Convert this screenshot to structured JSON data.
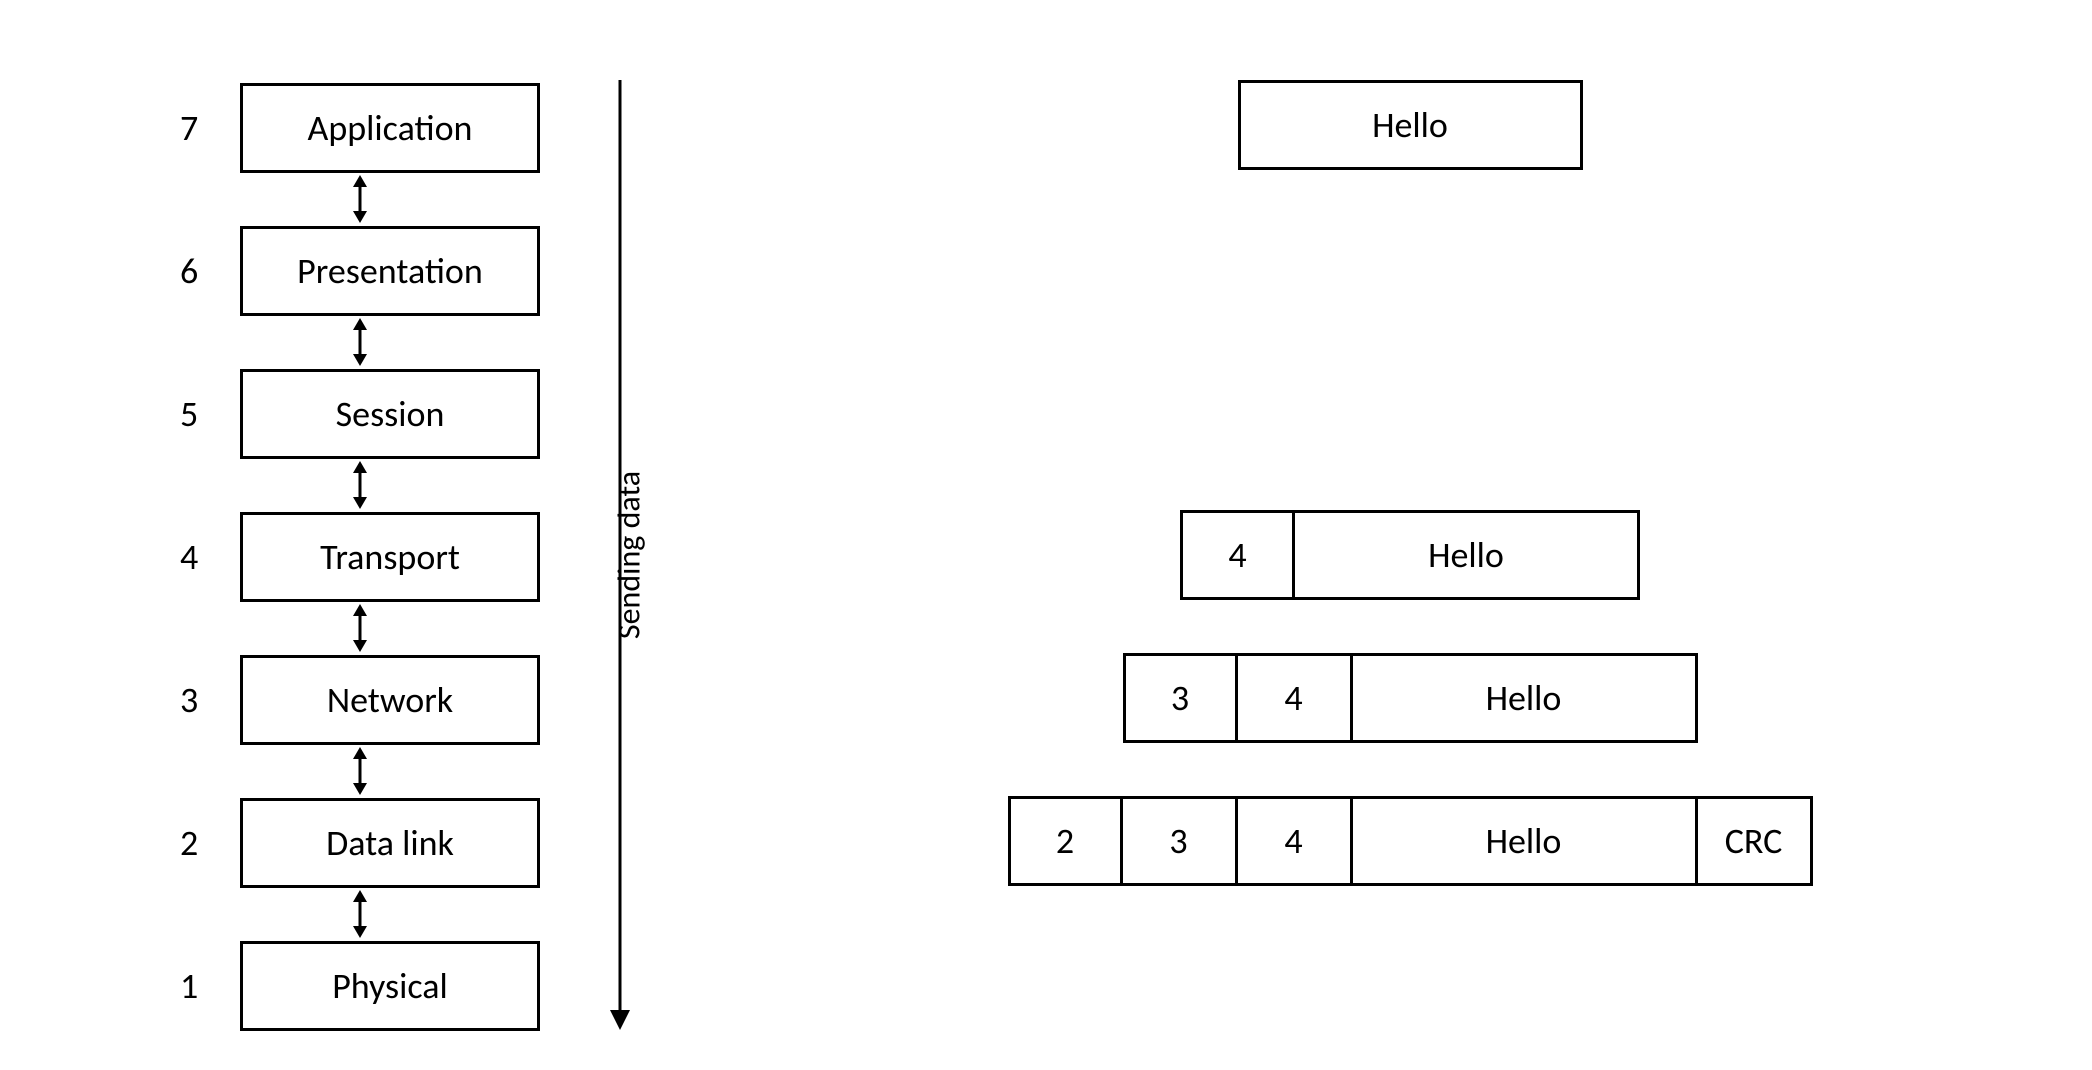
{
  "layers": [
    {
      "num": "7",
      "name": "Application"
    },
    {
      "num": "6",
      "name": "Presentation"
    },
    {
      "num": "5",
      "name": "Session"
    },
    {
      "num": "4",
      "name": "Transport"
    },
    {
      "num": "3",
      "name": "Network"
    },
    {
      "num": "2",
      "name": "Data link"
    },
    {
      "num": "1",
      "name": "Physical"
    }
  ],
  "arrow_label": "Sending data",
  "packets": {
    "row0": {
      "data": "Hello"
    },
    "row3": {
      "h4": "4",
      "data": "Hello"
    },
    "row4": {
      "h3": "3",
      "h4": "4",
      "data": "Hello"
    },
    "row5": {
      "h2": "2",
      "h3": "3",
      "h4": "4",
      "data": "Hello",
      "crc": "CRC"
    }
  }
}
